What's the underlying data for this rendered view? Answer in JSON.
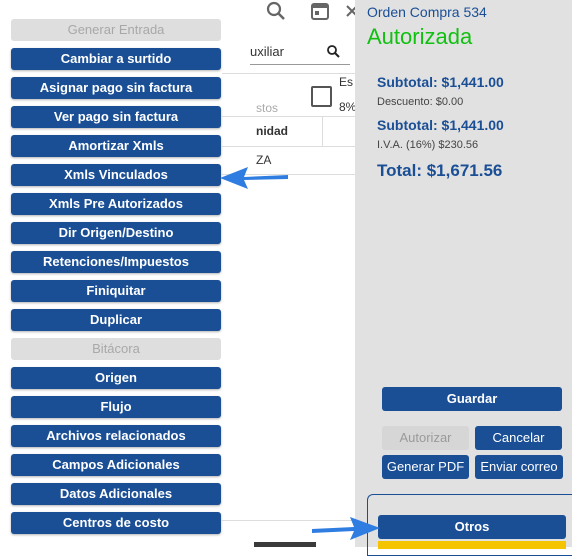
{
  "background": {
    "search_text": "uxiliar",
    "col_es": "Es",
    "col_pct": "8%",
    "col_costos": "stos",
    "col_unidad": "nidad",
    "row_text": "ZA"
  },
  "menu": {
    "items": [
      {
        "label": "Generar Entrada",
        "disabled": true
      },
      {
        "label": "Cambiar a surtido",
        "disabled": false
      },
      {
        "label": "Asignar pago sin factura",
        "disabled": false
      },
      {
        "label": "Ver pago sin factura",
        "disabled": false
      },
      {
        "label": "Amortizar Xmls",
        "disabled": false
      },
      {
        "label": "Xmls Vinculados",
        "disabled": false
      },
      {
        "label": "Xmls Pre Autorizados",
        "disabled": false
      },
      {
        "label": "Dir Origen/Destino",
        "disabled": false
      },
      {
        "label": "Retenciones/Impuestos",
        "disabled": false
      },
      {
        "label": "Finiquitar",
        "disabled": false
      },
      {
        "label": "Duplicar",
        "disabled": false
      },
      {
        "label": "Bitácora",
        "disabled": true
      },
      {
        "label": "Origen",
        "disabled": false
      },
      {
        "label": "Flujo",
        "disabled": false
      },
      {
        "label": "Archivos relacionados",
        "disabled": false
      },
      {
        "label": "Campos Adicionales",
        "disabled": false
      },
      {
        "label": "Datos Adicionales",
        "disabled": false
      },
      {
        "label": "Centros de costo",
        "disabled": false
      }
    ]
  },
  "panel": {
    "order_title": "Orden Compra 534",
    "status": "Autorizada",
    "subtotal1": "Subtotal: $1,441.00",
    "descuento": "Descuento: $0.00",
    "subtotal2": "Subtotal: $1,441.00",
    "iva": "I.V.A. (16%) $230.56",
    "total": "Total: $1,671.56",
    "buttons": {
      "guardar": "Guardar",
      "autorizar": "Autorizar",
      "cancelar": "Cancelar",
      "generar_pdf": "Generar PDF",
      "enviar_correo": "Enviar correo",
      "otros": "Otros"
    }
  },
  "colors": {
    "primary": "#1a4f96",
    "status_green": "#11c011",
    "panel_bg": "#e1e1e1",
    "arrow": "#2f7de0",
    "accent_yellow": "#f4c400"
  },
  "icons": [
    "search-icon",
    "calendar-icon",
    "close-icon",
    "arrow-pointer-icon"
  ]
}
